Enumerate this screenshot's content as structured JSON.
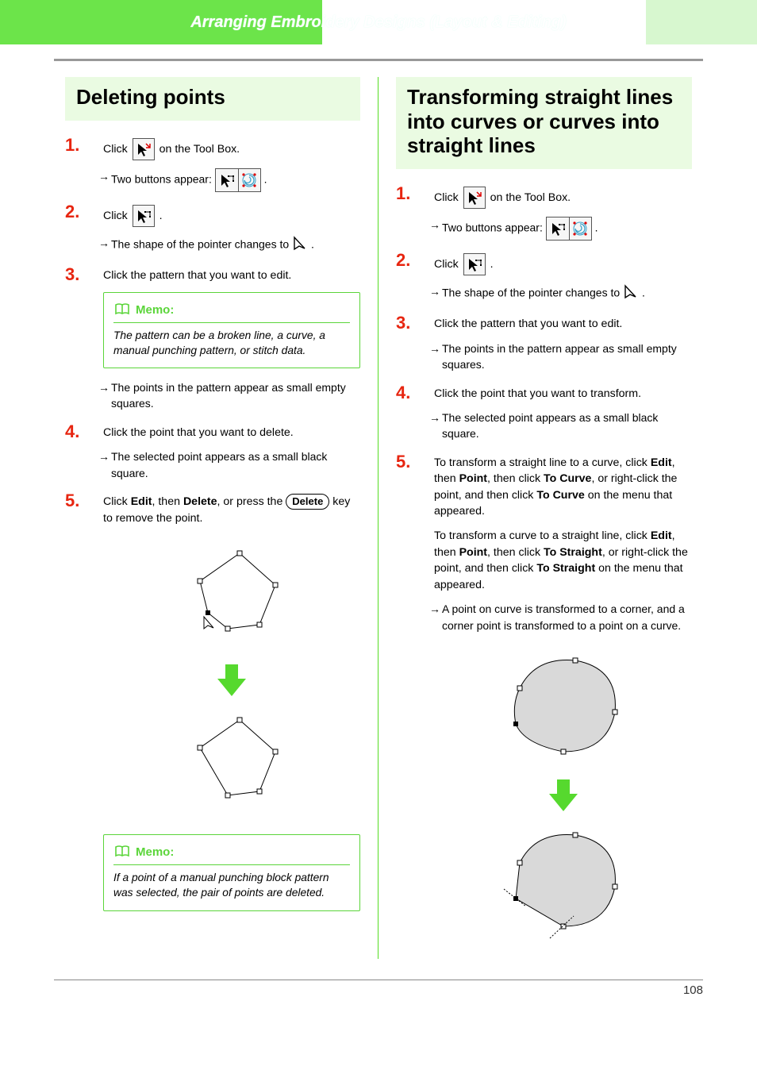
{
  "header": {
    "title": "Arranging Embroidery Designs (Layout & Editing)"
  },
  "pageNumber": "108",
  "left": {
    "heading": "Deleting points",
    "steps": {
      "s1": {
        "num": "1.",
        "pre": "Click ",
        "post": " on the Tool Box.",
        "sub_pre": "Two buttons appear: ",
        "sub_post": "."
      },
      "s2": {
        "num": "2.",
        "pre": "Click ",
        "post": ".",
        "sub_pre": "The shape of the pointer changes to ",
        "sub_post": " ."
      },
      "s3": {
        "num": "3.",
        "text": "Click the pattern that you want to edit."
      },
      "memo1": {
        "label": "Memo:",
        "body": "The pattern can be a broken line, a curve, a manual punching pattern, or stitch data."
      },
      "s3_sub": "The points in the pattern appear as small empty squares.",
      "s4": {
        "num": "4.",
        "text": "Click the point that you want to delete.",
        "sub": "The selected point appears as a small black square."
      },
      "s5": {
        "num": "5.",
        "pre": "Click ",
        "b1": "Edit",
        "mid1": ", then ",
        "b2": "Delete",
        "mid2": ", or press the ",
        "key": "Delete",
        "post": " key to remove the point."
      },
      "memo2": {
        "label": "Memo:",
        "body": "If a point of a manual punching block pattern was selected, the pair of points are deleted."
      }
    }
  },
  "right": {
    "heading": "Transforming straight lines into curves or curves into straight lines",
    "steps": {
      "s1": {
        "num": "1.",
        "pre": "Click ",
        "post": " on the Tool Box.",
        "sub_pre": "Two buttons appear: ",
        "sub_post": "."
      },
      "s2": {
        "num": "2.",
        "pre": "Click ",
        "post": ".",
        "sub_pre": "The shape of the pointer changes to ",
        "sub_post": " ."
      },
      "s3": {
        "num": "3.",
        "text": "Click the pattern that you want to edit.",
        "sub": "The points in the pattern appear as small empty squares."
      },
      "s4": {
        "num": "4.",
        "text": "Click the point that you want to transform.",
        "sub": "The selected point appears as a small black square."
      },
      "s5": {
        "num": "5.",
        "p1": {
          "t0": "To transform a straight line to a curve, click ",
          "b1": "Edit",
          "t1": ", then ",
          "b2": "Point",
          "t2": ", then click ",
          "b3": "To Curve",
          "t3": ", or right-click the point, and then click ",
          "b4": "To Curve",
          "t4": " on the menu that appeared."
        },
        "p2": {
          "t0": "To transform a curve to a straight line, click ",
          "b1": "Edit",
          "t1": ", then ",
          "b2": "Point",
          "t2": ", then click ",
          "b3": "To Straight",
          "t3": ", or right-click the point, and then click ",
          "b4": "To Straight",
          "t4": " on the menu that appeared."
        },
        "sub": "A point on curve is transformed to a corner, and a corner point is transformed to a point on a curve."
      }
    }
  }
}
